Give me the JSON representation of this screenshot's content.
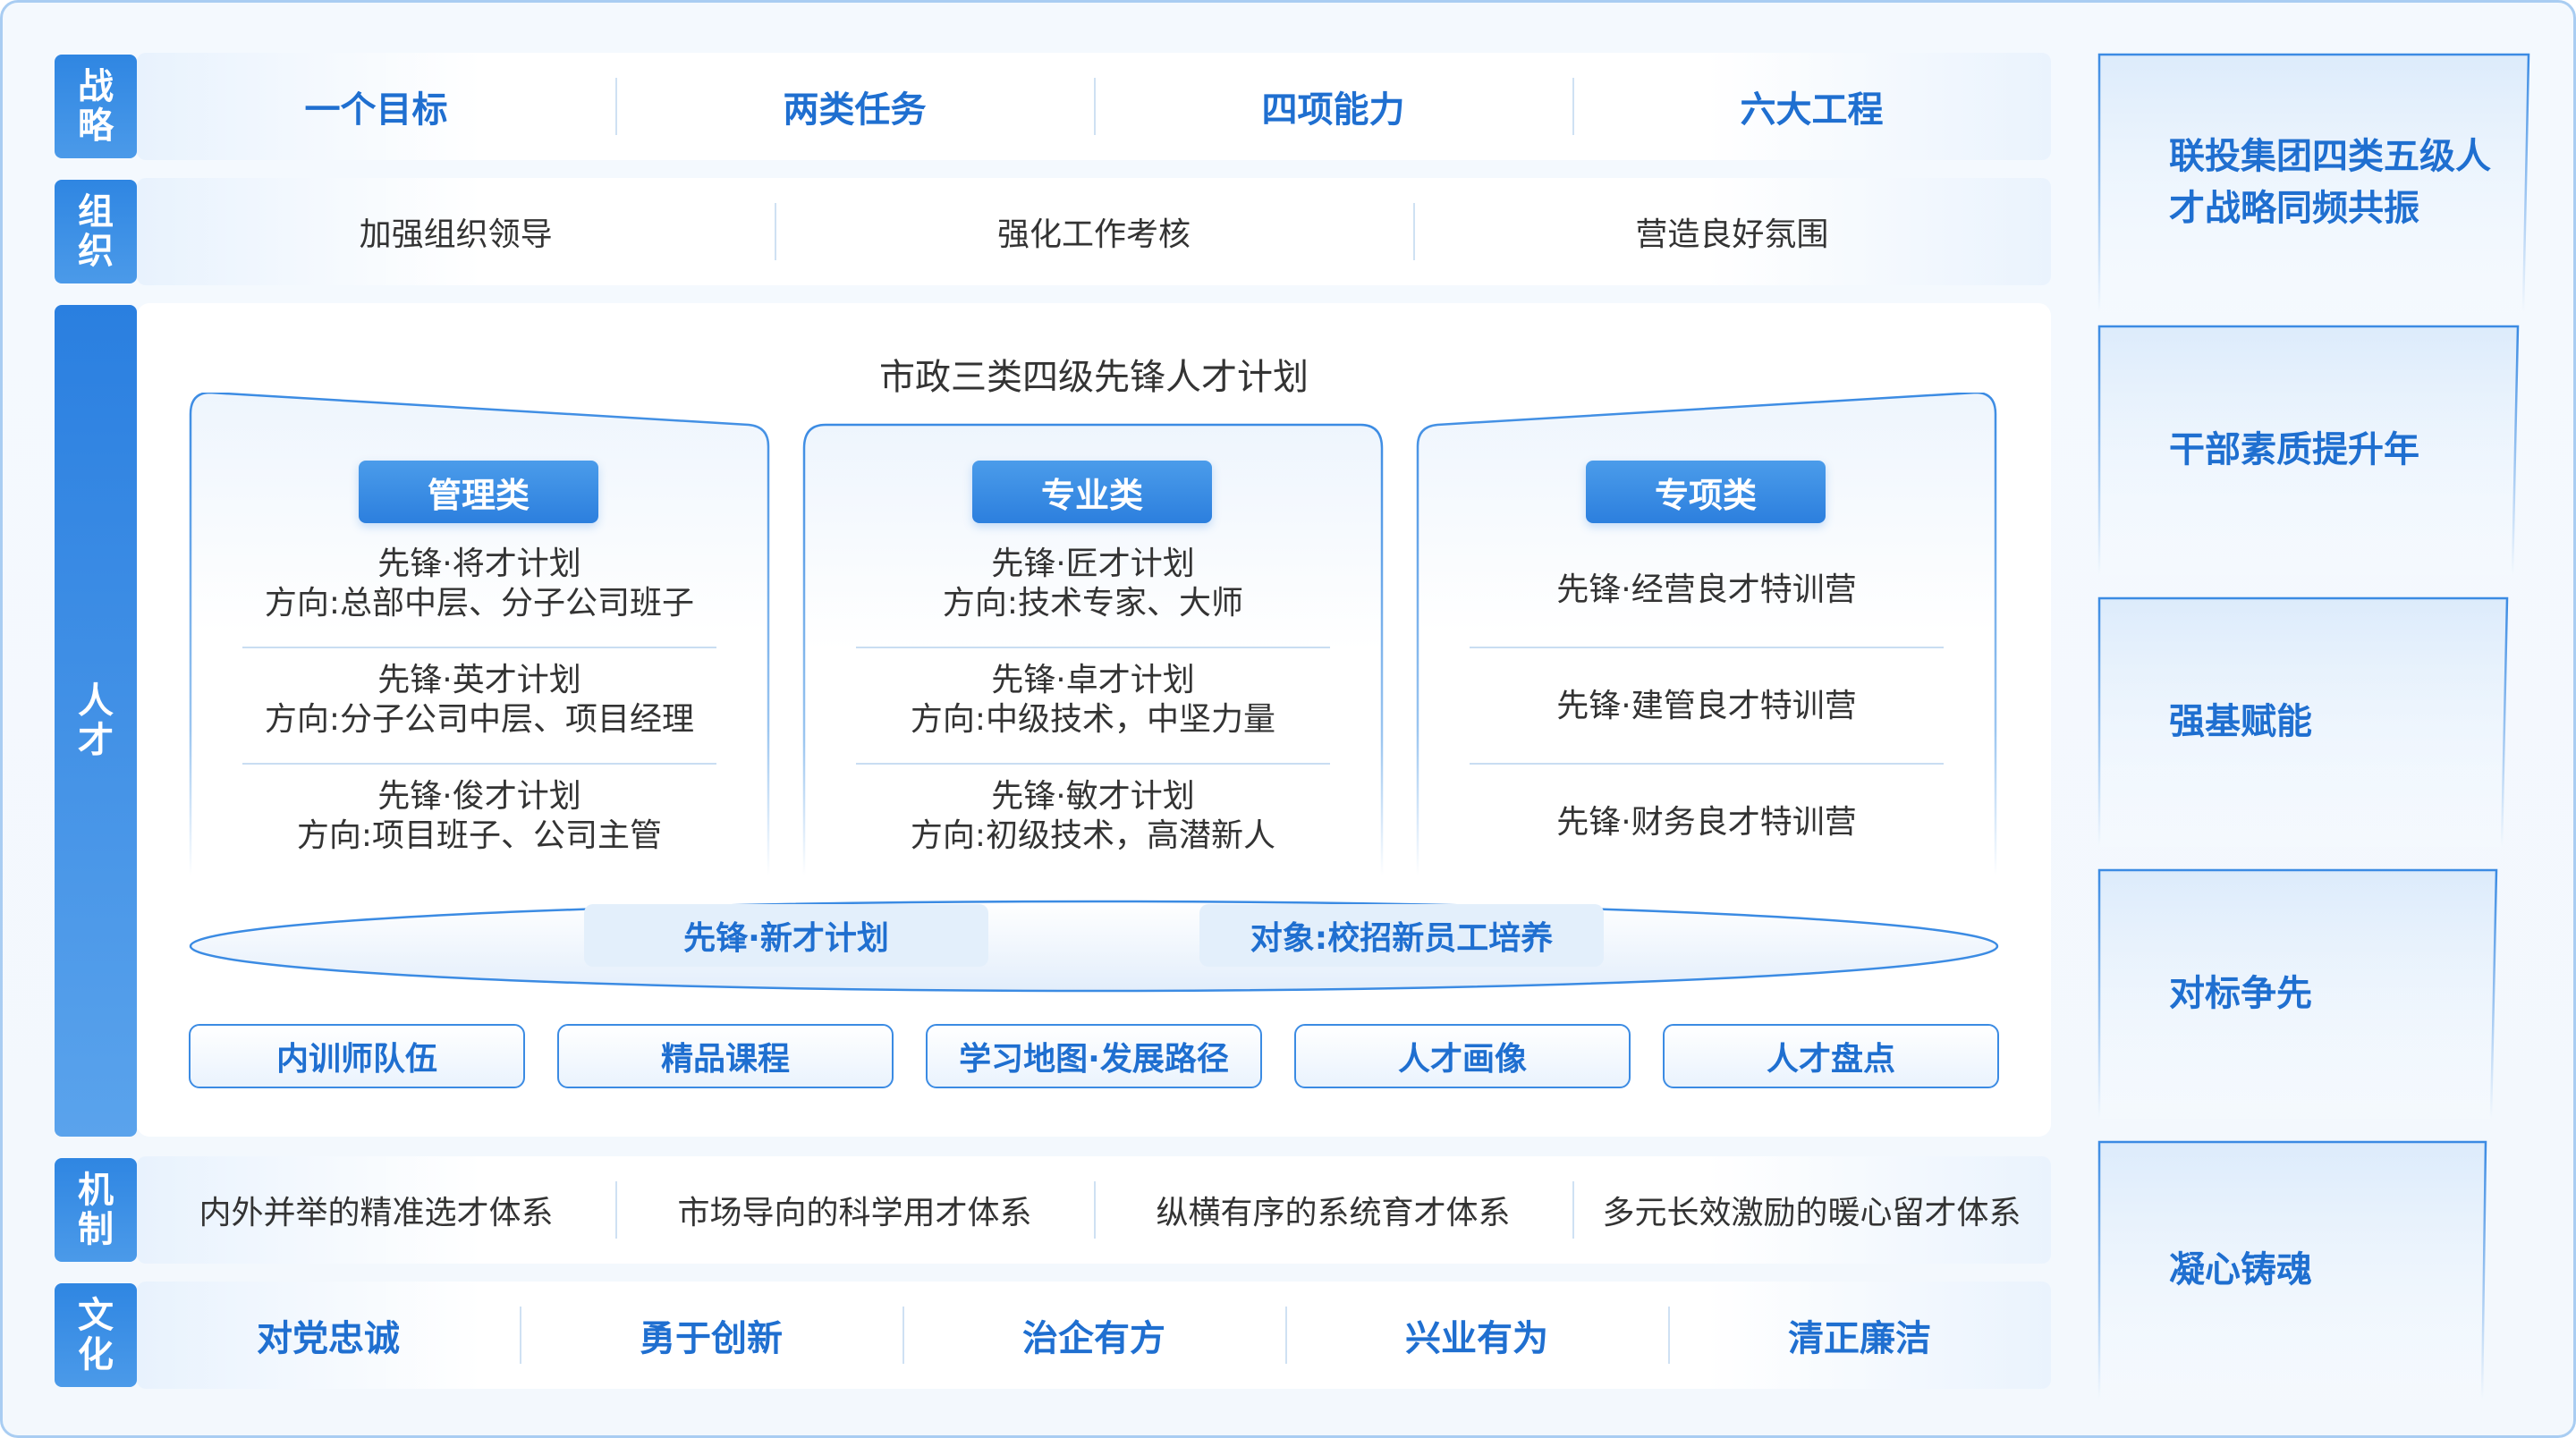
{
  "left_tabs": {
    "strategy": "战略",
    "organization": "组织",
    "talent": "人才",
    "mechanism": "机制",
    "culture": "文化"
  },
  "strategy_row": [
    "一个目标",
    "两类任务",
    "四项能力",
    "六大工程"
  ],
  "organization_row": [
    "加强组织领导",
    "强化工作考核",
    "营造良好氛围"
  ],
  "talent": {
    "plan_title": "市政三类四级先锋人才计划",
    "categories": [
      {
        "label": "管理类",
        "items": [
          {
            "line1": "先锋·将才计划",
            "line2": "方向:总部中层、分子公司班子"
          },
          {
            "line1": "先锋·英才计划",
            "line2": "方向:分子公司中层、项目经理"
          },
          {
            "line1": "先锋·俊才计划",
            "line2": "方向:项目班子、公司主管"
          }
        ]
      },
      {
        "label": "专业类",
        "items": [
          {
            "line1": "先锋·匠才计划",
            "line2": "方向:技术专家、大师"
          },
          {
            "line1": "先锋·卓才计划",
            "line2": "方向:中级技术，中坚力量"
          },
          {
            "line1": "先锋·敏才计划",
            "line2": "方向:初级技术，高潜新人"
          }
        ]
      },
      {
        "label": "专项类",
        "items": [
          "先锋·经营良才特训营",
          "先锋·建管良才特训营",
          "先锋·财务良才特训营"
        ]
      }
    ],
    "new_talent": {
      "plan": "先锋·新才计划",
      "target": "对象:校招新员工培养"
    },
    "tools": [
      "内训师队伍",
      "精品课程",
      "学习地图·发展路径",
      "人才画像",
      "人才盘点"
    ]
  },
  "mechanism_row": [
    "内外并举的精准选才体系",
    "市场导向的科学用才体系",
    "纵横有序的系统育才体系",
    "多元长效激励的暖心留才体系"
  ],
  "culture_row": [
    "对党忠诚",
    "勇于创新",
    "治企有方",
    "兴业有为",
    "清正廉洁"
  ],
  "right_panel": [
    "联投集团四类五级人才战略同频共振",
    "干部素质提升年",
    "强基赋能",
    "对标争先",
    "凝心铸魂"
  ],
  "colors": {
    "accent": "#1f6fd0",
    "tab": "#2f86e2",
    "border": "#a9cdf2"
  }
}
